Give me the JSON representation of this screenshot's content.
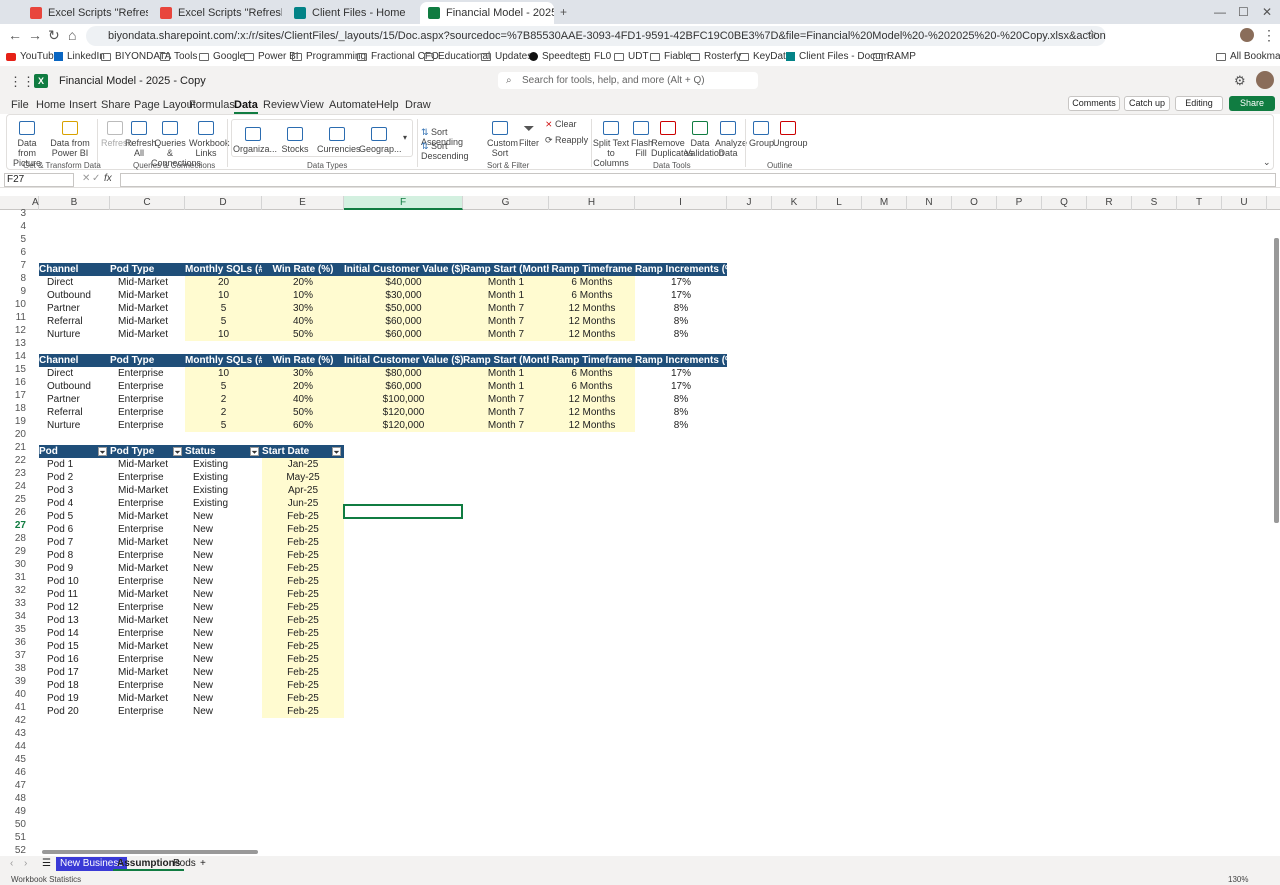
{
  "browser": {
    "tabs": [
      {
        "title": "Excel Scripts \"Refresh All\" func...",
        "color": "#e8453c"
      },
      {
        "title": "Excel Scripts \"Refresh All\" funct...",
        "color": "#e8453c"
      },
      {
        "title": "Client Files - Home",
        "color": "#038387"
      },
      {
        "title": "Financial Model - 2025 - Copy...",
        "color": "#107c41"
      }
    ],
    "url": "biyondata.sharepoint.com/:x:/r/sites/ClientFiles/_layouts/15/Doc.aspx?sourcedoc=%7B85530AAE-3093-4FD1-9591-42BFC19C0BE3%7D&file=Financial%20Model%20-%202025%20-%20Copy.xlsx&action=default&mobileredirect=true",
    "bookmarks": [
      "YouTube",
      "LinkedIn",
      "BIYONDATA",
      "Tools",
      "Google",
      "Power BI",
      "Programming",
      "Fractional CFO",
      "Educational",
      "Updates",
      "Speedtest",
      "FL0",
      "UDT",
      "Fiable",
      "Rosterfy",
      "KeyData",
      "Client Files - Docum...",
      "RAMP"
    ],
    "all_bookmarks": "All Bookmarks"
  },
  "app": {
    "file_title": "Financial Model - 2025 - Copy",
    "search_placeholder": "Search for tools, help, and more (Alt + Q)",
    "menus": [
      "File",
      "Home",
      "Insert",
      "Share",
      "Page Layout",
      "Formulas",
      "Data",
      "Review",
      "View",
      "Automate",
      "Help",
      "Draw"
    ],
    "active_menu": "Data",
    "comments": "Comments",
    "catch_up": "Catch up",
    "editing": "Editing",
    "share": "Share"
  },
  "ribbon": {
    "buttons": [
      {
        "label": "Data from Picture"
      },
      {
        "label": "Data from Power BI"
      },
      {
        "label": "Refresh"
      },
      {
        "label": "Refresh All"
      },
      {
        "label": "Queries & Connections"
      },
      {
        "label": "Workbook Links"
      },
      {
        "label": "Organiza..."
      },
      {
        "label": "Stocks"
      },
      {
        "label": "Currencies"
      },
      {
        "label": "Geograp..."
      },
      {
        "label": "Sort Ascending"
      },
      {
        "label": "Sort Descending"
      },
      {
        "label": "Custom Sort"
      },
      {
        "label": "Filter"
      },
      {
        "label": "Clear"
      },
      {
        "label": "Reapply"
      },
      {
        "label": "Split Text to Columns"
      },
      {
        "label": "Flash Fill"
      },
      {
        "label": "Remove Duplicates"
      },
      {
        "label": "Data Validation"
      },
      {
        "label": "Analyze Data"
      },
      {
        "label": "Group"
      },
      {
        "label": "Ungroup"
      }
    ],
    "groups": [
      "Get & Transform Data",
      "Queries & Connections",
      "Data Types",
      "Sort & Filter",
      "Data Tools",
      "Outline"
    ]
  },
  "formula_bar": {
    "name_box": "F27",
    "fx": "fx",
    "formula": ""
  },
  "columns": [
    "A",
    "B",
    "C",
    "D",
    "E",
    "F",
    "G",
    "H",
    "I",
    "J",
    "K",
    "L",
    "M",
    "N",
    "O",
    "P",
    "Q",
    "R",
    "S",
    "T",
    "U"
  ],
  "rows": [
    "3",
    "4",
    "5",
    "6",
    "7",
    "8",
    "9",
    "10",
    "11",
    "12",
    "13",
    "14",
    "15",
    "16",
    "17",
    "18",
    "19",
    "20",
    "21",
    "22",
    "23",
    "24",
    "25",
    "26",
    "27",
    "28",
    "29",
    "30",
    "31",
    "32",
    "33",
    "34",
    "35",
    "36",
    "37",
    "38",
    "39",
    "40",
    "41",
    "42",
    "43",
    "44",
    "45",
    "46",
    "47",
    "48",
    "49",
    "50",
    "51",
    "52"
  ],
  "table1": {
    "headers": [
      "Channel",
      "Pod Type",
      "Monthly SQLs (#)",
      "Win Rate (%)",
      "Initial Customer Value ($)",
      "Ramp Start (Month)",
      "Ramp Timeframe",
      "Ramp Increments (%)"
    ],
    "rows": [
      [
        "Direct",
        "Mid-Market",
        "20",
        "20%",
        "$40,000",
        "Month 1",
        "6 Months",
        "17%"
      ],
      [
        "Outbound",
        "Mid-Market",
        "10",
        "10%",
        "$30,000",
        "Month 1",
        "6 Months",
        "17%"
      ],
      [
        "Partner",
        "Mid-Market",
        "5",
        "30%",
        "$50,000",
        "Month 7",
        "12 Months",
        "8%"
      ],
      [
        "Referral",
        "Mid-Market",
        "5",
        "40%",
        "$60,000",
        "Month 7",
        "12 Months",
        "8%"
      ],
      [
        "Nurture",
        "Mid-Market",
        "10",
        "50%",
        "$60,000",
        "Month 7",
        "12 Months",
        "8%"
      ]
    ]
  },
  "table2": {
    "headers": [
      "Channel",
      "Pod Type",
      "Monthly SQLs (#)",
      "Win Rate (%)",
      "Initial Customer Value ($)",
      "Ramp Start (Month)",
      "Ramp Timeframe",
      "Ramp Increments (%)"
    ],
    "rows": [
      [
        "Direct",
        "Enterprise",
        "10",
        "30%",
        "$80,000",
        "Month 1",
        "6 Months",
        "17%"
      ],
      [
        "Outbound",
        "Enterprise",
        "5",
        "20%",
        "$60,000",
        "Month 1",
        "6 Months",
        "17%"
      ],
      [
        "Partner",
        "Enterprise",
        "2",
        "40%",
        "$100,000",
        "Month 7",
        "12 Months",
        "8%"
      ],
      [
        "Referral",
        "Enterprise",
        "2",
        "50%",
        "$120,000",
        "Month 7",
        "12 Months",
        "8%"
      ],
      [
        "Nurture",
        "Enterprise",
        "5",
        "60%",
        "$120,000",
        "Month 7",
        "12 Months",
        "8%"
      ]
    ]
  },
  "table3": {
    "headers": [
      "Pod",
      "Pod Type",
      "Status",
      "Start Date"
    ],
    "rows": [
      [
        "Pod 1",
        "Mid-Market",
        "Existing",
        "Jan-25"
      ],
      [
        "Pod 2",
        "Enterprise",
        "Existing",
        "May-25"
      ],
      [
        "Pod 3",
        "Mid-Market",
        "Existing",
        "Apr-25"
      ],
      [
        "Pod 4",
        "Enterprise",
        "Existing",
        "Jun-25"
      ],
      [
        "Pod 5",
        "Mid-Market",
        "New",
        "Feb-25"
      ],
      [
        "Pod 6",
        "Enterprise",
        "New",
        "Feb-25"
      ],
      [
        "Pod 7",
        "Mid-Market",
        "New",
        "Feb-25"
      ],
      [
        "Pod 8",
        "Enterprise",
        "New",
        "Feb-25"
      ],
      [
        "Pod 9",
        "Mid-Market",
        "New",
        "Feb-25"
      ],
      [
        "Pod 10",
        "Enterprise",
        "New",
        "Feb-25"
      ],
      [
        "Pod 11",
        "Mid-Market",
        "New",
        "Feb-25"
      ],
      [
        "Pod 12",
        "Enterprise",
        "New",
        "Feb-25"
      ],
      [
        "Pod 13",
        "Mid-Market",
        "New",
        "Feb-25"
      ],
      [
        "Pod 14",
        "Enterprise",
        "New",
        "Feb-25"
      ],
      [
        "Pod 15",
        "Mid-Market",
        "New",
        "Feb-25"
      ],
      [
        "Pod 16",
        "Enterprise",
        "New",
        "Feb-25"
      ],
      [
        "Pod 17",
        "Mid-Market",
        "New",
        "Feb-25"
      ],
      [
        "Pod 18",
        "Enterprise",
        "New",
        "Feb-25"
      ],
      [
        "Pod 19",
        "Mid-Market",
        "New",
        "Feb-25"
      ],
      [
        "Pod 20",
        "Enterprise",
        "New",
        "Feb-25"
      ]
    ]
  },
  "sheets": [
    {
      "name": "New Business",
      "active": false,
      "highlight": true
    },
    {
      "name": "Assumptions",
      "active": true,
      "highlight": false
    },
    {
      "name": "Pods",
      "active": false,
      "highlight": false
    }
  ],
  "status": {
    "left": "Workbook Statistics",
    "zoom": "130%"
  }
}
